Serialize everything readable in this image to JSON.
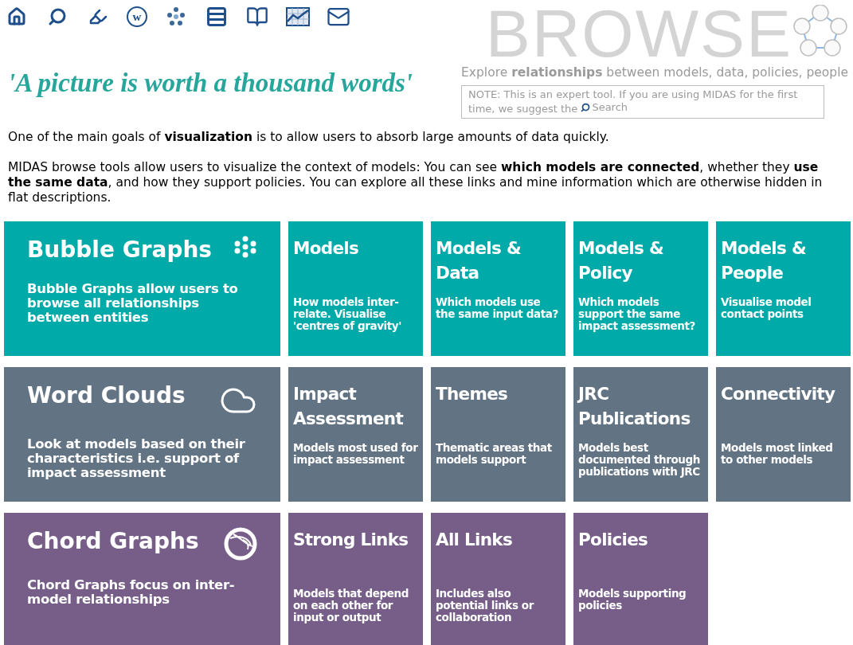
{
  "nav": [
    {
      "kind": "home"
    },
    {
      "kind": "search"
    },
    {
      "kind": "highlighter"
    },
    {
      "kind": "letter",
      "glyph": "w"
    },
    {
      "kind": "bubbles"
    },
    {
      "kind": "list"
    },
    {
      "kind": "book"
    },
    {
      "kind": "chart"
    },
    {
      "kind": "mail"
    }
  ],
  "logo": {
    "text": "BROWSE"
  },
  "tagline": "'A picture is worth a thousand words'",
  "subtitle": "Explore **relationships** between models, data, policies, people",
  "note": {
    "text": "NOTE: This is an expert tool. If you are using MIDAS for the first time, we suggest the",
    "link": "Search"
  },
  "intro": [
    "One of the main goals of **visualization** is to allow users to absorb large amounts of data quickly.",
    "MIDAS browse tools allow users to visualize the context of models: You can see **which models are connected**, whether they **use the same data**, and how they support policies. You can explore all these links and mine information which are otherwise hidden in flat descriptions."
  ],
  "groups": [
    {
      "kind": "bubble",
      "color": "#00aaa8",
      "title": "Bubble Graphs",
      "description": "Bubble Graphs allow users to browse all relationships between entities",
      "tiles": [
        {
          "title": "Models",
          "description": "How models inter-relate. Visualise 'centres of gravity'"
        },
        {
          "title": "Models & Data",
          "description": "Which models use the same input data?"
        },
        {
          "title": "Models & Policy",
          "description": "Which models support the same impact assessment?"
        },
        {
          "title": "Models & People",
          "description": "Visualise model contact points"
        }
      ]
    },
    {
      "kind": "cloud",
      "color": "#627384",
      "title": "Word Clouds",
      "description": "Look at models based on their characteristics i.e. support of impact assessment",
      "tiles": [
        {
          "title": "Impact Assessment",
          "description": "Models most used for impact assessment"
        },
        {
          "title": "Themes",
          "description": "Thematic areas that models support"
        },
        {
          "title": "JRC Publications",
          "description": "Models best documented through publications with JRC"
        },
        {
          "title": "Connectivity",
          "description": "Models most linked to other models"
        }
      ]
    },
    {
      "kind": "chord",
      "color": "#765e88",
      "title": "Chord Graphs",
      "description": "Chord Graphs focus on inter-model relationships",
      "tiles": [
        {
          "title": "Strong Links",
          "description": "Models that depend on each other for input or output"
        },
        {
          "title": "All Links",
          "description": "Includes also potential links or collaboration"
        },
        {
          "title": "Policies",
          "description": "Models supporting policies"
        }
      ]
    }
  ]
}
